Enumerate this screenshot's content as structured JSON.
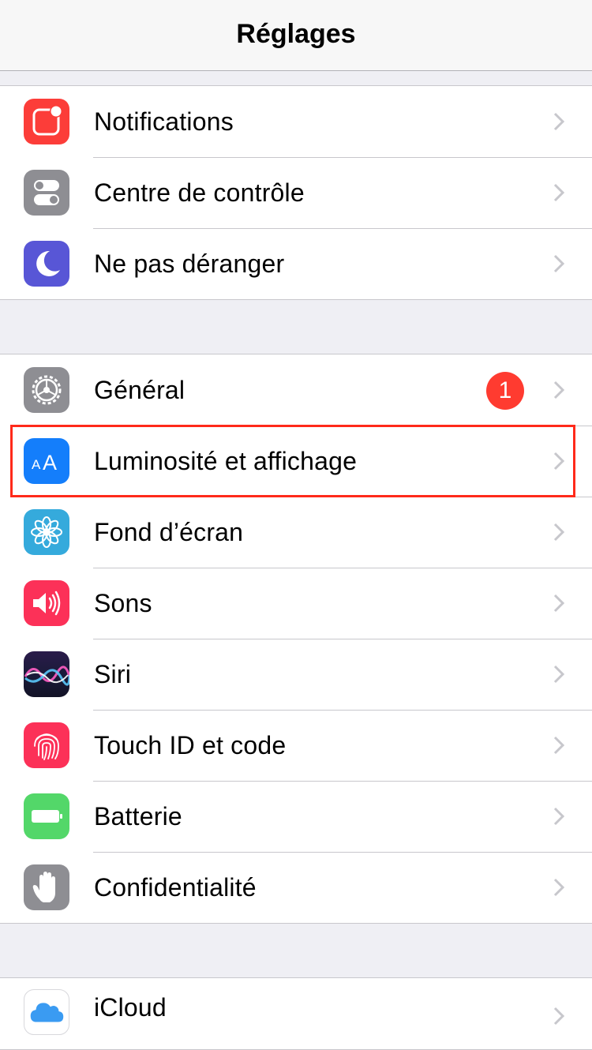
{
  "navbar": {
    "title": "Réglages"
  },
  "group1": [
    {
      "label": "Notifications",
      "icon": "notifications-icon",
      "color": "#fc3d39"
    },
    {
      "label": "Centre de contrôle",
      "icon": "control-center-icon",
      "color": "#8e8e93"
    },
    {
      "label": "Ne pas déranger",
      "icon": "moon-icon",
      "color": "#5856d6"
    }
  ],
  "group2": [
    {
      "label": "Général",
      "icon": "gear-icon",
      "color": "#8e8e93",
      "badge": "1"
    },
    {
      "label": "Luminosité et affichage",
      "icon": "text-size-icon",
      "color": "#147efb",
      "icon_text": "AA"
    },
    {
      "label": "Fond d’écran",
      "icon": "flower-icon",
      "color": "#35aadc"
    },
    {
      "label": "Sons",
      "icon": "speaker-icon",
      "color": "#fc3158"
    },
    {
      "label": "Siri",
      "icon": "siri-icon",
      "color": "#1b1b3a"
    },
    {
      "label": "Touch ID et code",
      "icon": "fingerprint-icon",
      "color": "#fc3158"
    },
    {
      "label": "Batterie",
      "icon": "battery-icon",
      "color": "#53d769"
    },
    {
      "label": "Confidentialité",
      "icon": "hand-icon",
      "color": "#8e8e93"
    }
  ],
  "group3": [
    {
      "label": "iCloud",
      "icon": "icloud-icon",
      "color": "#ffffff"
    }
  ],
  "highlight_color": "#ff2a1a"
}
